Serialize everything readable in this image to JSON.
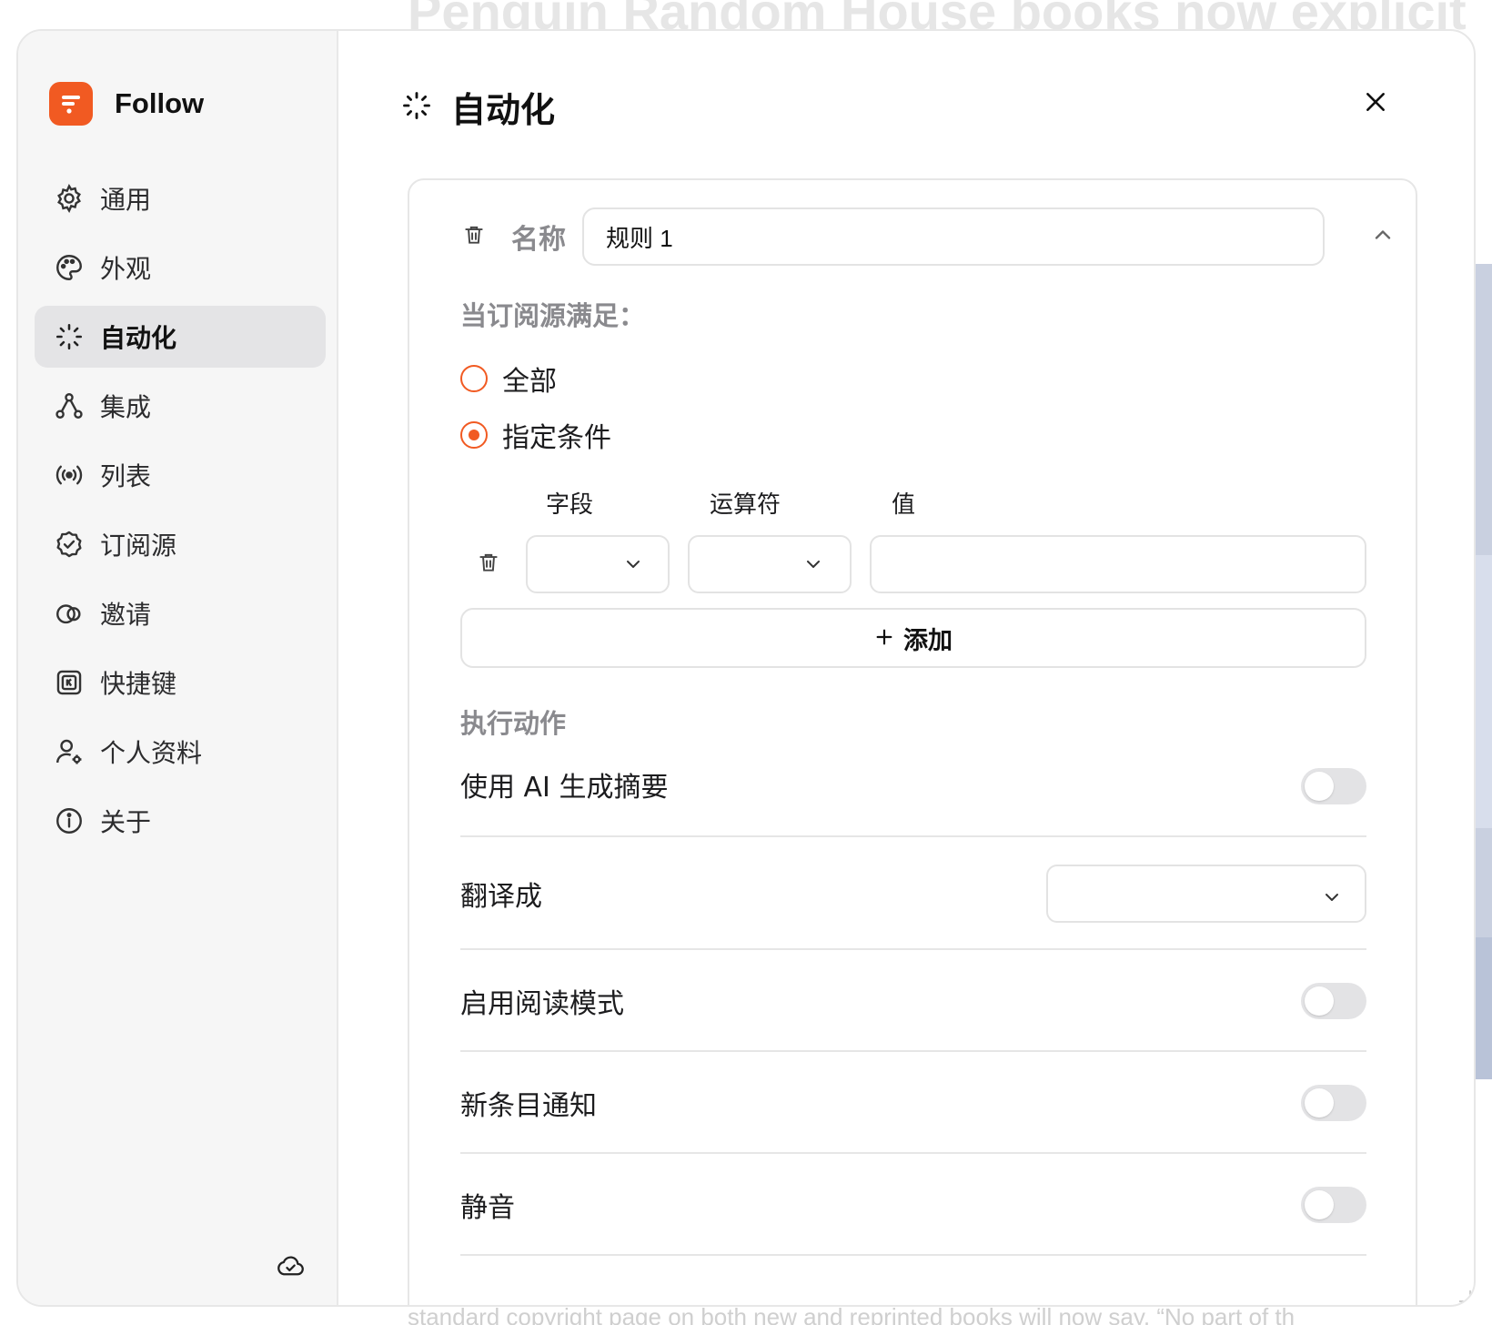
{
  "background": {
    "headline": "Penguin Random House books now explicit",
    "footer": "standard copyright page on both new and reprinted books will now say, “No part of th"
  },
  "app": {
    "name": "Follow",
    "accent_color": "#f15a22"
  },
  "sidebar": {
    "items": [
      {
        "label": "通用",
        "icon": "gear-icon"
      },
      {
        "label": "外观",
        "icon": "palette-icon"
      },
      {
        "label": "自动化",
        "icon": "sparkle-icon",
        "active": true
      },
      {
        "label": "集成",
        "icon": "network-icon"
      },
      {
        "label": "列表",
        "icon": "broadcast-icon"
      },
      {
        "label": "订阅源",
        "icon": "check-badge-icon"
      },
      {
        "label": "邀请",
        "icon": "invite-icon"
      },
      {
        "label": "快捷键",
        "icon": "keyboard-icon"
      },
      {
        "label": "个人资料",
        "icon": "user-settings-icon"
      },
      {
        "label": "关于",
        "icon": "info-icon"
      }
    ],
    "footer_icon": "cloud-check-icon"
  },
  "page": {
    "title": "自动化",
    "icon": "sparkle-icon"
  },
  "rule": {
    "name_label": "名称",
    "name_value": "规则 1",
    "condition_heading": "当订阅源满足：",
    "options": [
      {
        "label": "全部",
        "selected": false
      },
      {
        "label": "指定条件",
        "selected": true
      }
    ],
    "columns": {
      "field": "字段",
      "operator": "运算符",
      "value": "值"
    },
    "conditions": [
      {
        "field": "",
        "operator": "",
        "value": ""
      }
    ],
    "add_label": "添加",
    "actions_heading": "执行动作",
    "actions": {
      "summary": {
        "label": "使用 AI 生成摘要",
        "enabled": false
      },
      "translate": {
        "label": "翻译成",
        "value": ""
      },
      "readability": {
        "label": "启用阅读模式",
        "enabled": false
      },
      "notify": {
        "label": "新条目通知",
        "enabled": false
      },
      "mute": {
        "label": "静音",
        "enabled": false
      }
    }
  }
}
